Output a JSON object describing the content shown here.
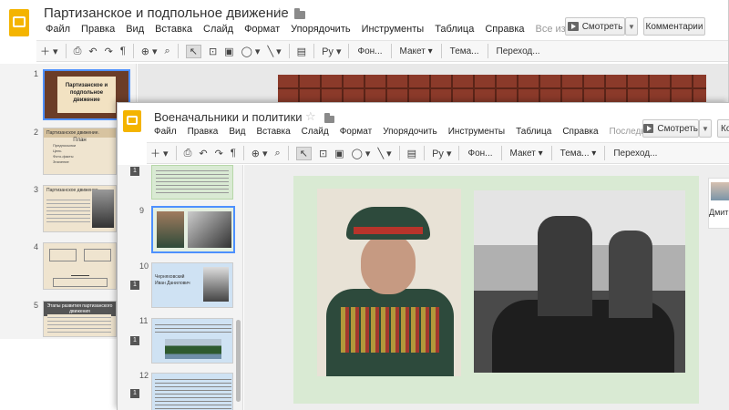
{
  "back_window": {
    "title": "Партизанское и подпольное движение",
    "menu": [
      "Файл",
      "Правка",
      "Вид",
      "Вставка",
      "Слайд",
      "Формат",
      "Упорядочить",
      "Инструменты",
      "Таблица",
      "Справка"
    ],
    "save_status": "Все изменения ...",
    "present_label": "Смотреть",
    "comments_label": "Комментарии",
    "toolbar": {
      "font_label": "Фон...",
      "layout_label": "Макет",
      "theme_label": "Тема...",
      "transition_label": "Переход..."
    },
    "slides": [
      {
        "num": "1",
        "text_a": "Партизанское и",
        "text_b": "подпольное",
        "text_c": "движение"
      },
      {
        "num": "2",
        "header": "Партизанское движение.",
        "sub": "План",
        "items": [
          "Предпосылки",
          "Цель",
          "Фото-факты",
          "Значение"
        ]
      },
      {
        "num": "3",
        "header": "Партизанское движение"
      },
      {
        "num": "4"
      },
      {
        "num": "5",
        "header": "Этапы развития партизанского движения"
      }
    ]
  },
  "front_window": {
    "title": "Военачальники и политики",
    "menu": [
      "Файл",
      "Правка",
      "Вид",
      "Вставка",
      "Слайд",
      "Формат",
      "Упорядочить",
      "Инструменты",
      "Таблица",
      "Справка"
    ],
    "save_status": "Последнее изм...",
    "present_label": "Смотреть",
    "comments_partial": "Ко",
    "toolbar": {
      "font_label": "Фон...",
      "layout_label": "Макет",
      "theme_label": "Тема...",
      "transition_label": "Переход..."
    },
    "slides": [
      {
        "num": "9"
      },
      {
        "num": "10",
        "caption": "Черняховский Иван Данилович"
      },
      {
        "num": "11"
      },
      {
        "num": "12"
      }
    ],
    "user_name_partial": "Дмит"
  },
  "colors": {
    "logo": "#f4b400",
    "selection": "#4d90fe",
    "slide_green": "#d9ead3",
    "brick": "#8b3a2a"
  }
}
